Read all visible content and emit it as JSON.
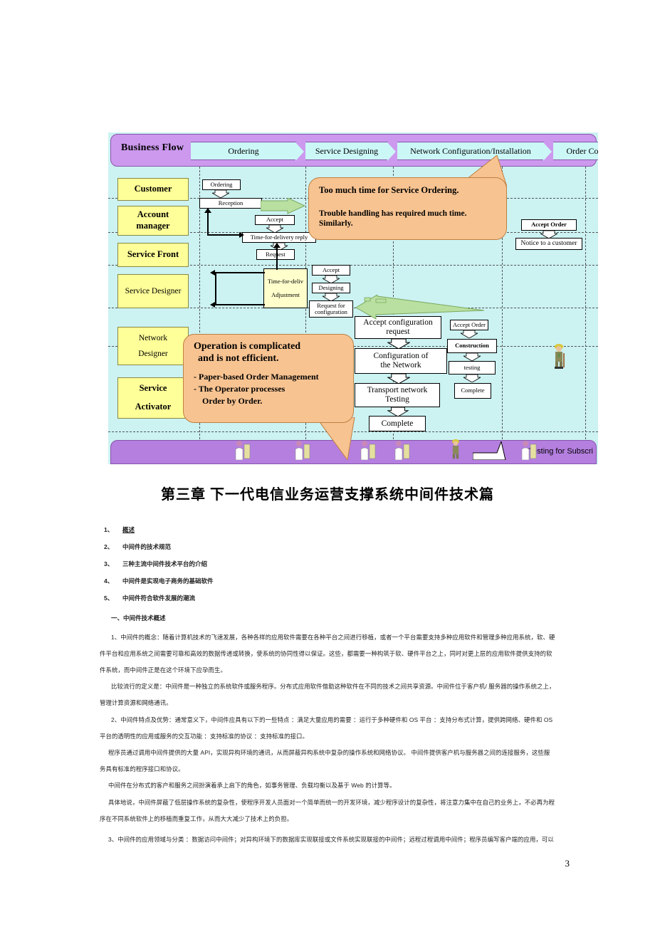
{
  "diagram": {
    "flow": {
      "title": "Business Flow",
      "phases": [
        "Ordering",
        "Service Designing",
        "Network Configuration/Installation",
        "Order Completion/"
      ]
    },
    "roles": [
      "Customer",
      "Account\nmanager",
      "Service Front",
      "Service Designer",
      "Network\nDesigner",
      "Service\nActivator"
    ],
    "boxes": {
      "ordering": "Ordering",
      "reception": "Reception",
      "accept1": "Accept",
      "time_for_delivery_reply": "Time-for-delivery reply",
      "request": "Request",
      "time_for_deliv_adjust_l1": "Time-for-deliv",
      "time_for_deliv_adjust_l2": "Adjustment",
      "accept2": "Accept",
      "designing": "Designing",
      "request_for_config_l1": "Request for",
      "request_for_config_l2": "configuration",
      "accept_config_request_l1": "Accept configuration",
      "accept_config_request_l2": "request",
      "configuration_of_network_l1": "Configuration of",
      "configuration_of_network_l2": "the Network",
      "transport_network_testing_l1": "Transport network",
      "transport_network_testing_l2": "Testing",
      "complete1": "Complete",
      "accept_order_mid": "Accept Order",
      "construction": "Construction",
      "testing": "testing",
      "complete2": "Complete",
      "accept_order_right": "Accept Order",
      "notice_to_customer": "Notice to a customer"
    },
    "callout_a": {
      "line1": "Too much time for Service Ordering.",
      "line2": "Trouble handling has required much time.",
      "line3": "Similarly."
    },
    "callout_b": {
      "line1": "Operation is complicated",
      "line2": "and  is not efficient.",
      "line3": "- Paper-based Order Management",
      "line4": "- The Operator processes",
      "line5": "Order by Order."
    },
    "bottom_label": "Testing for Subscri",
    "colors": {
      "flow_bar": "#cc99ee",
      "bottom_bar": "#b57fe0",
      "canvas": "#ccf2f2",
      "phase_chevron": "#ccf7f7",
      "role_box": "#ffff99",
      "callout": "#f7c391",
      "green_arrow": "#a6d98a"
    }
  },
  "document": {
    "chapter_title": "第三章   下一代电信业务运营支撑系统中间件技术篇",
    "toc": [
      {
        "num": "1、",
        "text": "概述"
      },
      {
        "num": "2、",
        "text": "中间件的技术规范"
      },
      {
        "num": "3、",
        "text": "三种主流中间件技术平台的介绍"
      },
      {
        "num": "4、",
        "text": "中间件是实现电子商务的基础软件"
      },
      {
        "num": "5、",
        "text": "中间件符合软件发展的潮流"
      }
    ],
    "section_heading": "一、中间件技术概述",
    "paragraphs": [
      "1、中间件的概念：随着计算机技术的飞速发展，各种各样的应用软件需要在各种平台之间进行移植，或者一个平台需要支持多种应用软件和管理多种应用系统，软、硬",
      "件平台和应用系统之间需要可靠和高效的数据传递或转换，使系统的协同性得以保证。这些，都需要一种构筑于软、硬件平台之上，同时对更上层的应用软件提供支持的软",
      "件系统，而中间件正是在这个环境下应孕而生。",
      "比较流行的定义是：中间件是一种独立的系统软件或服务程序。分布式应用软件借助这种软件在不同的技术之间共享资源。中间件位于客户机/ 服务器的操作系统之上，",
      "管理计算资源和网络通讯。",
      "2、中间件特点及优势：通常意义下，中间件应具有以下的一些特点 ：满足大量应用的需要 ：运行于多种硬件和 OS 平台 ：支持分布式计算，提供跨网络、硬件和 OS",
      "平台的透明性的应用或服务的交互功能 ：支持标准的协议 ：支持标准的接口。",
      "程序员通过调用中间件提供的大量 API，实现异构环境的通讯，从而屏蔽异构系统中复杂的操作系统和网络协议。  中间件提供客户机与服务器之间的连接服务，这些服",
      "务具有标准的程序接口和协议。",
      "中间件在分布式的客户和服务之间扮演着承上启下的角色，如事务管理、负载均衡以及基于 Web 的计算等。",
      "具体地说，中间件屏蔽了低层操作系统的复杂性，使程序开发人员面对一个简单而统一的开发环境，减少程序设计的复杂性，将注意力集中在自己的业务上，不必再为程",
      "序在不同系统软件上的移植而重复工作，从而大大减少了技术上的负担。",
      "3、中间件的应用领域与分类 ：数据访问中间件；对异构环境下的数据库实现联接或文件系统实现联接的中间件；远程过程调用中间件；程序员编写客户端的应用，可以"
    ],
    "page_number": "3"
  }
}
